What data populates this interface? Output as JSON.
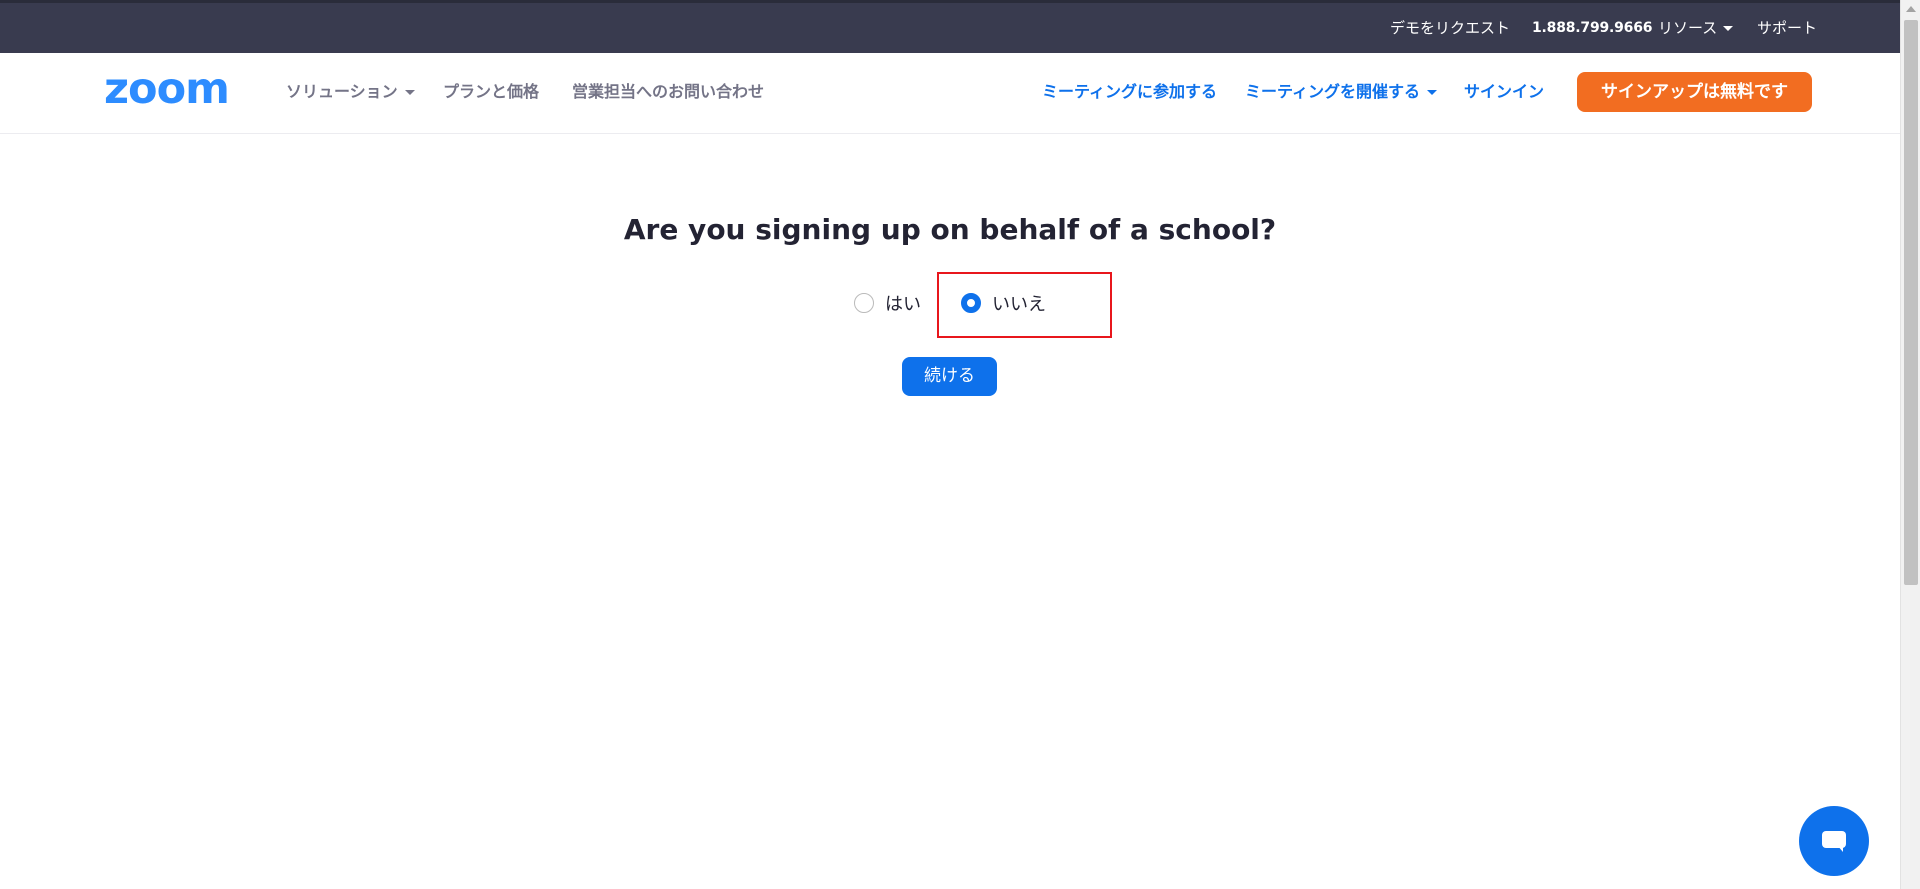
{
  "topbar": {
    "request_demo": "デモをリクエスト",
    "phone": "1.888.799.9666",
    "resources": "リソース",
    "support": "サポート"
  },
  "header": {
    "logo_text": "zoom",
    "solutions": "ソリューション",
    "plans_pricing": "プランと価格",
    "contact_sales": "営業担当へのお問い合わせ",
    "join_meeting": "ミーティングに参加する",
    "host_meeting": "ミーティングを開催する",
    "sign_in": "サインイン",
    "signup_free": "サインアップは無料です"
  },
  "main": {
    "question": "Are you signing up on behalf of a school?",
    "options": [
      {
        "label": "はい",
        "selected": false
      },
      {
        "label": "いいえ",
        "selected": true
      }
    ],
    "continue_label": "続ける"
  },
  "colors": {
    "topbar_bg": "#393b4f",
    "brand_blue": "#0e71eb",
    "logo_blue": "#2d8cff",
    "signup_orange": "#f26d21",
    "highlight_red": "#e8161c"
  },
  "icons": {
    "chat": "chat-icon",
    "dropdown": "chevron-down-icon"
  }
}
